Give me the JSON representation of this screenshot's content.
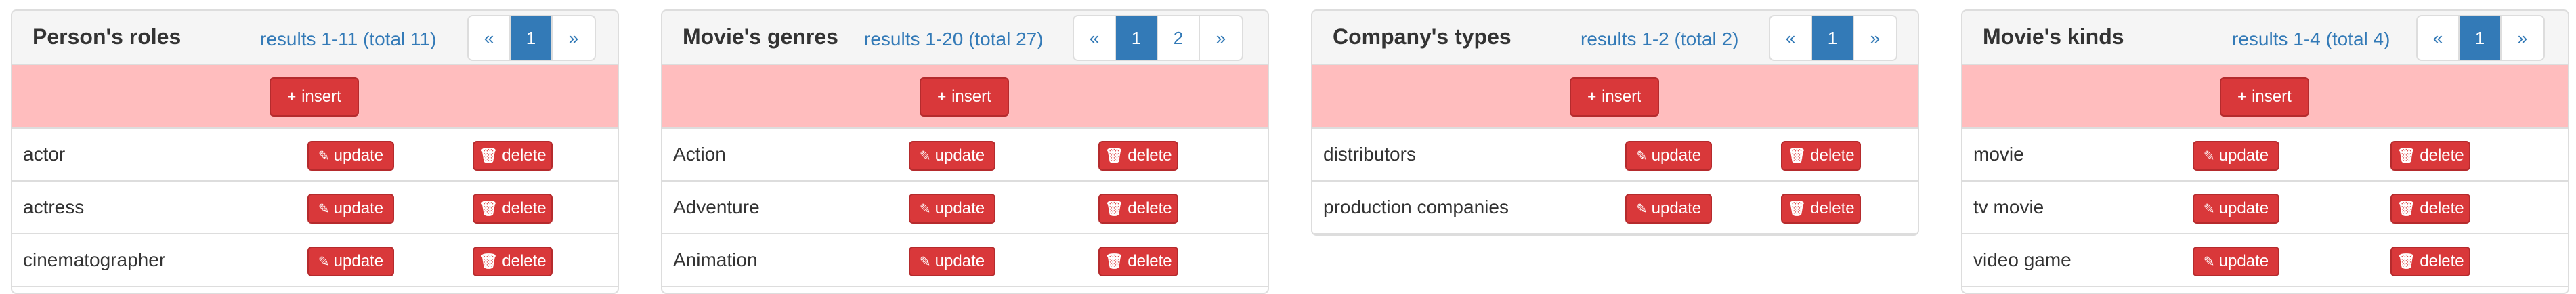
{
  "buttons": {
    "insert": "insert",
    "update": "update",
    "delete": "delete"
  },
  "icons": {
    "insert": "plus-icon",
    "update": "pencil-icon",
    "delete": "trash-icon"
  },
  "colors": {
    "accent": "#337ab7",
    "danger": "#d9383a",
    "insert_row": "#ffbdbe"
  },
  "panels": [
    {
      "title": "Person's roles",
      "results": "results 1-11 (total 11)",
      "pager": [
        "«",
        "1",
        "»"
      ],
      "active_page": "1",
      "rows": [
        "actor",
        "actress",
        "cinematographer"
      ]
    },
    {
      "title": "Movie's genres",
      "results": "results 1-20 (total 27)",
      "pager": [
        "«",
        "1",
        "2",
        "»"
      ],
      "active_page": "1",
      "rows": [
        "Action",
        "Adventure",
        "Animation"
      ]
    },
    {
      "title": "Company's types",
      "results": "results 1-2 (total 2)",
      "pager": [
        "«",
        "1",
        "»"
      ],
      "active_page": "1",
      "rows": [
        "distributors",
        "production companies"
      ]
    },
    {
      "title": "Movie's kinds",
      "results": "results 1-4 (total 4)",
      "pager": [
        "«",
        "1",
        "»"
      ],
      "active_page": "1",
      "rows": [
        "movie",
        "tv movie",
        "video game"
      ]
    }
  ]
}
